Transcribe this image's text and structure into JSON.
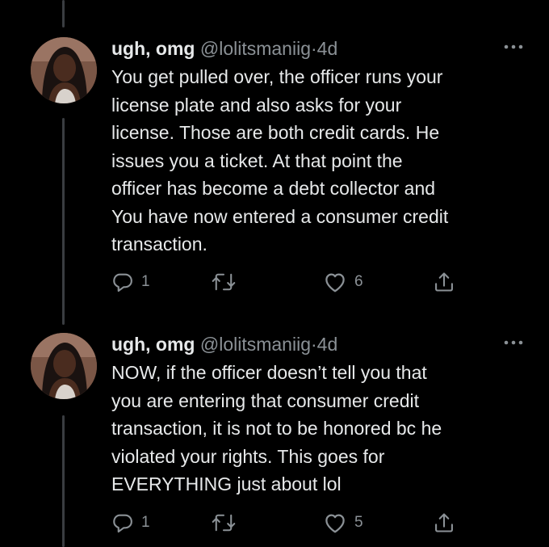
{
  "tweets": [
    {
      "name": "ugh, omg",
      "handle": "@lolitsmaniig",
      "separator": "·",
      "age": "4d",
      "text": "You get pulled over, the officer runs your\nlicense plate and also asks for your\nlicense. Those are both credit cards. He\nissues you a ticket. At that point the\nofficer has become a debt collector and\nYou have now entered a consumer credit\ntransaction.",
      "reply_count": "1",
      "retweet_count": "",
      "like_count": "6"
    },
    {
      "name": "ugh, omg",
      "handle": "@lolitsmaniig",
      "separator": "·",
      "age": "4d",
      "text": "NOW, if the officer doesn’t tell you that\nyou are entering that consumer credit\ntransaction, it is not to be honored bc he\nviolated your rights. This goes for\nEVERYTHING just about lol",
      "reply_count": "1",
      "retweet_count": "",
      "like_count": "5"
    }
  ],
  "colors": {
    "background": "#000000",
    "text": "#e7e9ea",
    "secondary": "#8b9196",
    "thread_line": "#3a3d41"
  },
  "icons": {
    "reply": "reply-icon",
    "retweet": "retweet-icon",
    "like": "like-icon",
    "share": "share-icon",
    "more": "more-icon"
  }
}
